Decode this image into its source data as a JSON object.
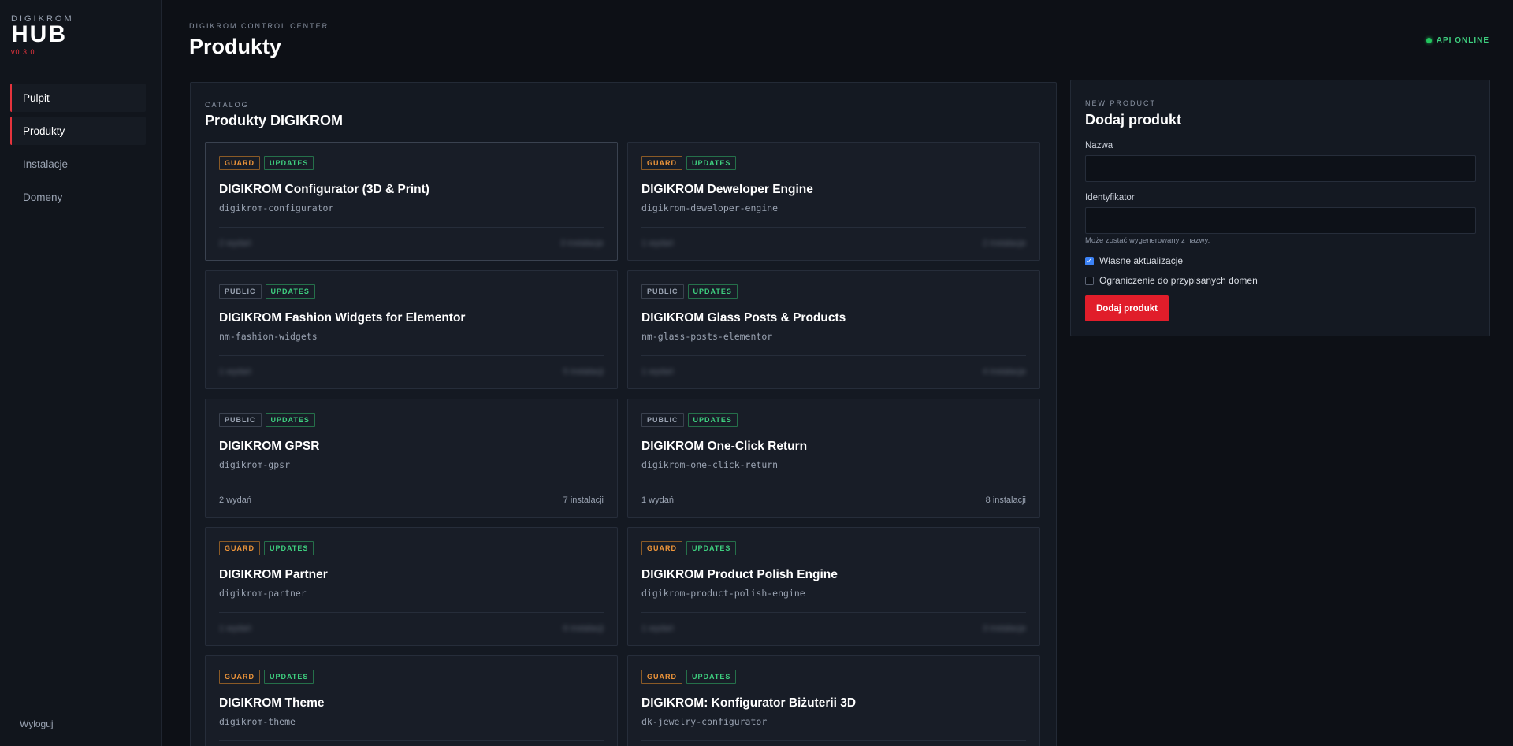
{
  "brand": {
    "small": "DIGIKROM",
    "big": "HUB",
    "version": "v0.3.0"
  },
  "sidebar": {
    "items": [
      {
        "label": "Pulpit"
      },
      {
        "label": "Produkty"
      },
      {
        "label": "Instalacje"
      },
      {
        "label": "Domeny"
      }
    ],
    "logout": "Wyloguj"
  },
  "header": {
    "eyebrow": "DIGIKROM CONTROL CENTER",
    "title": "Produkty"
  },
  "api_status": "API ONLINE",
  "catalog": {
    "eyebrow": "CATALOG",
    "title": "Produkty DIGIKROM",
    "products": [
      {
        "badges": [
          "GUARD",
          "UPDATES"
        ],
        "name": "DIGIKROM Configurator (3D & Print)",
        "slug": "digikrom-configurator",
        "releases": "2 wydań",
        "installs": "3 instalacje"
      },
      {
        "badges": [
          "GUARD",
          "UPDATES"
        ],
        "name": "DIGIKROM Deweloper Engine",
        "slug": "digikrom-deweloper-engine",
        "releases": "1 wydań",
        "installs": "2 instalacje"
      },
      {
        "badges": [
          "PUBLIC",
          "UPDATES"
        ],
        "name": "DIGIKROM Fashion Widgets for Elementor",
        "slug": "nm-fashion-widgets",
        "releases": "1 wydań",
        "installs": "5 instalacji"
      },
      {
        "badges": [
          "PUBLIC",
          "UPDATES"
        ],
        "name": "DIGIKROM Glass Posts & Products",
        "slug": "nm-glass-posts-elementor",
        "releases": "1 wydań",
        "installs": "4 instalacje"
      },
      {
        "badges": [
          "PUBLIC",
          "UPDATES"
        ],
        "name": "DIGIKROM GPSR",
        "slug": "digikrom-gpsr",
        "releases": "2 wydań",
        "installs": "7 instalacji"
      },
      {
        "badges": [
          "PUBLIC",
          "UPDATES"
        ],
        "name": "DIGIKROM One-Click Return",
        "slug": "digikrom-one-click-return",
        "releases": "1 wydań",
        "installs": "8 instalacji"
      },
      {
        "badges": [
          "GUARD",
          "UPDATES"
        ],
        "name": "DIGIKROM Partner",
        "slug": "digikrom-partner",
        "releases": "1 wydań",
        "installs": "6 instalacji"
      },
      {
        "badges": [
          "GUARD",
          "UPDATES"
        ],
        "name": "DIGIKROM Product Polish Engine",
        "slug": "digikrom-product-polish-engine",
        "releases": "1 wydań",
        "installs": "3 instalacje"
      },
      {
        "badges": [
          "GUARD",
          "UPDATES"
        ],
        "name": "DIGIKROM Theme",
        "slug": "digikrom-theme",
        "releases": "",
        "installs": ""
      },
      {
        "badges": [
          "GUARD",
          "UPDATES"
        ],
        "name": "DIGIKROM: Konfigurator Biżuterii 3D",
        "slug": "dk-jewelry-configurator",
        "releases": "",
        "installs": ""
      }
    ]
  },
  "form": {
    "eyebrow": "NEW PRODUCT",
    "title": "Dodaj produkt",
    "name_label": "Nazwa",
    "name_value": "",
    "id_label": "Identyfikator",
    "id_value": "",
    "hint": "Może zostać wygenerowany z nazwy.",
    "checkbox_updates": {
      "label": "Własne aktualizacje",
      "checked": true
    },
    "checkbox_domains": {
      "label": "Ograniczenie do przypisanych domen",
      "checked": false
    },
    "submit": "Dodaj produkt"
  }
}
